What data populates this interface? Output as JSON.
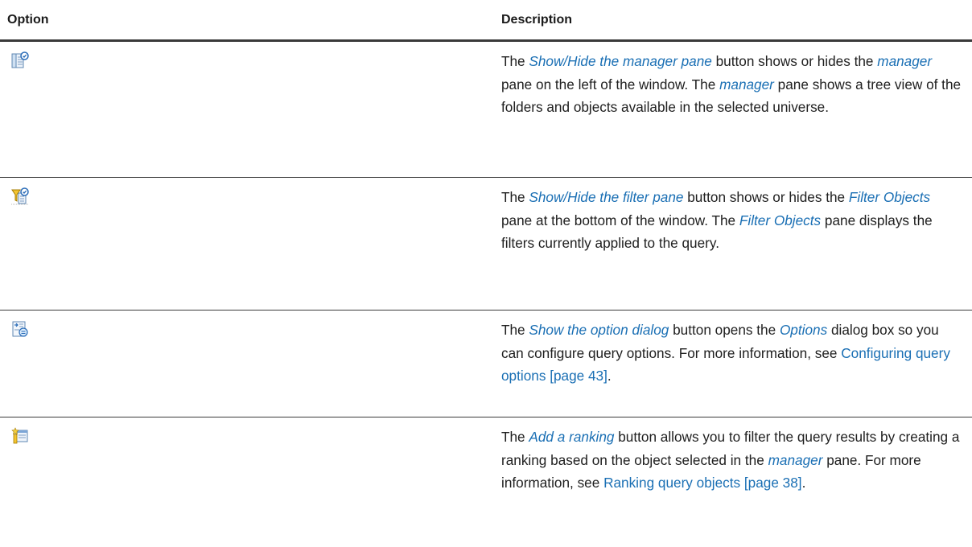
{
  "header": {
    "option": "Option",
    "description": "Description"
  },
  "rows": [
    {
      "icon": "show-hide-manager-pane-icon",
      "d": {
        "t0": "The ",
        "i0": "Show/Hide the manager pane",
        "t1": " button shows or hides the ",
        "i1": "manager",
        "t2": " pane on the left of the window. The ",
        "i2": "manager",
        "t3": " pane shows a tree view of the folders and objects available in the selected universe."
      }
    },
    {
      "icon": "show-hide-filter-pane-icon",
      "d": {
        "t0": "The ",
        "i0": "Show/Hide the filter pane",
        "t1": " button shows or hides the ",
        "i1": "Filter Objects",
        "t2": " pane at the bottom of the window. The ",
        "i2": "Filter Objects",
        "t3": " pane displays the filters currently applied to the query."
      }
    },
    {
      "icon": "show-option-dialog-icon",
      "d": {
        "t0": "The ",
        "i0": "Show the option dialog",
        "t1": " button opens the ",
        "i1": "Options",
        "t2": " dialog box so you can configure query options. For more information, see ",
        "l0": "Configuring query options [page 43]",
        "t3": "."
      }
    },
    {
      "icon": "add-ranking-icon",
      "d": {
        "t0": "The ",
        "i0": "Add a ranking",
        "t1": " button allows you to filter the query results by creating a ranking based on the object selected in the ",
        "i1": "manager",
        "t2": " pane. For more information, see ",
        "l0": "Ranking query objects [page 38]",
        "t3": "."
      }
    }
  ]
}
